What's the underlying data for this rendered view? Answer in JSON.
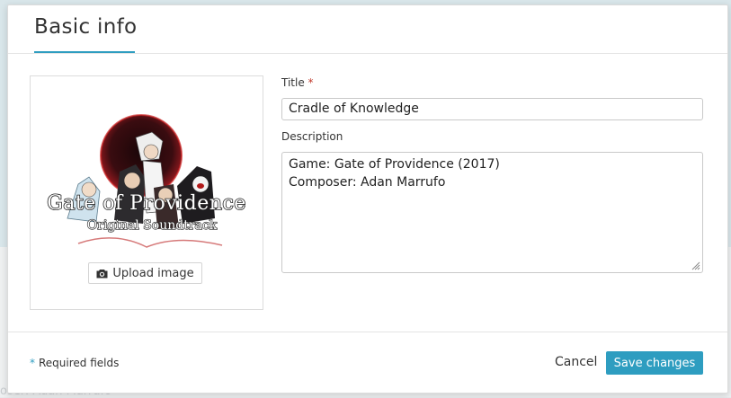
{
  "background": {
    "obscured_text": "oser: Adan Marrufo"
  },
  "modal": {
    "title": "Basic info",
    "accent_color": "#2e9dc0"
  },
  "image_panel": {
    "cover_alt": "Gate of Providence Original Soundtrack cover art",
    "cover_line1": "Gate of Providence",
    "cover_line2": "Original Soundtrack",
    "upload_icon": "camera-icon",
    "upload_label": "Upload image"
  },
  "form": {
    "title_label": "Title",
    "title_required_marker": "*",
    "title_value": "Cradle of Knowledge",
    "description_label": "Description",
    "description_value": "Game: Gate of Providence (2017)\nComposer: Adan Marrufo"
  },
  "footer": {
    "required_marker": "*",
    "required_note": "Required fields",
    "cancel_label": "Cancel",
    "save_label": "Save changes",
    "save_color": "#2e9dc0"
  }
}
